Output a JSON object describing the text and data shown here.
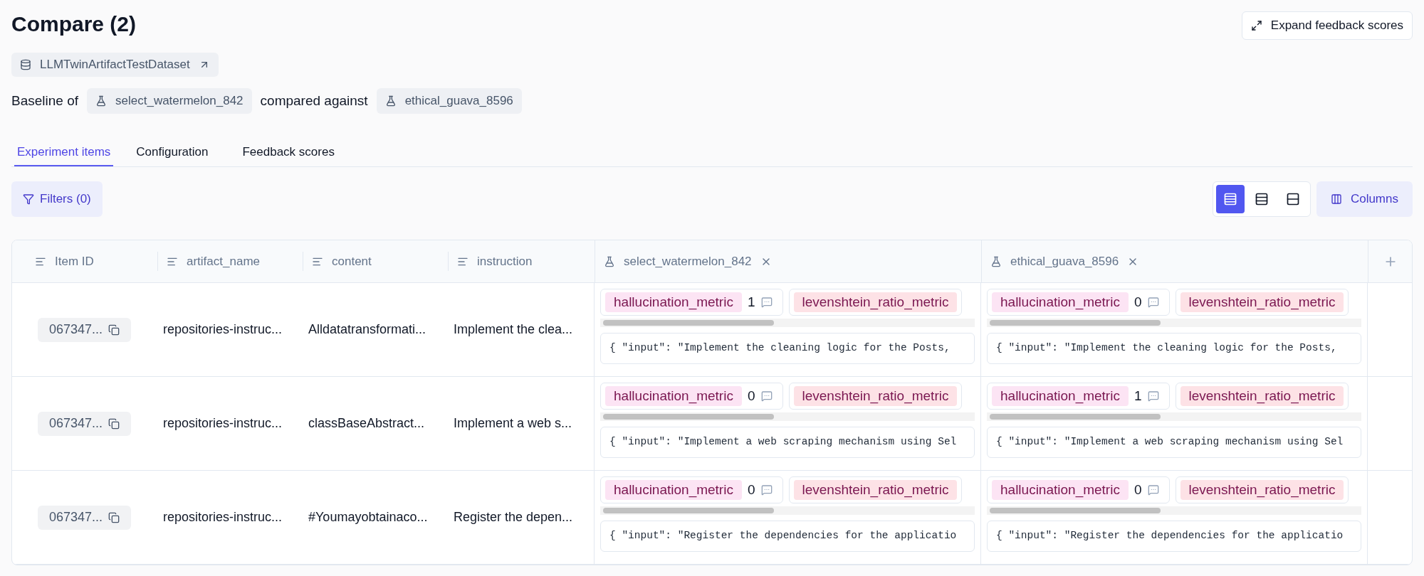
{
  "header": {
    "title": "Compare (2)",
    "expand_button": "Expand feedback scores"
  },
  "dataset": {
    "name": "LLMTwinArtifactTestDataset"
  },
  "comparison": {
    "baseline_label": "Baseline of",
    "baseline": "select_watermelon_842",
    "against_label": "compared against",
    "against": "ethical_guava_8596"
  },
  "tabs": [
    {
      "label": "Experiment items",
      "selected": true
    },
    {
      "label": "Configuration",
      "selected": false
    },
    {
      "label": "Feedback scores",
      "selected": false
    }
  ],
  "toolbar": {
    "filters": "Filters (0)",
    "row_heights": [
      {
        "kind": "large",
        "selected": true
      },
      {
        "kind": "medium",
        "selected": false
      },
      {
        "kind": "small",
        "selected": false
      }
    ],
    "columns_button": "Columns"
  },
  "table": {
    "columns": [
      "Item ID",
      "artifact_name",
      "content",
      "instruction"
    ],
    "experiment_columns": [
      "select_watermelon_842",
      "ethical_guava_8596"
    ],
    "rows": [
      {
        "item_id": "067347...",
        "artifact_name": "repositories-instruc...",
        "content": "Alldatatransformati...",
        "instruction": "Implement the clea...",
        "experiments": [
          {
            "scores": [
              {
                "name": "hallucination_metric",
                "value": "1",
                "color": "#fce4f4"
              },
              {
                "name": "levenshtein_ratio_metric",
                "color": "#fde2e6"
              }
            ],
            "output": "{ \"input\": \"Implement the cleaning logic for the Posts,"
          },
          {
            "scores": [
              {
                "name": "hallucination_metric",
                "value": "0",
                "color": "#fce4f4"
              },
              {
                "name": "levenshtein_ratio_metric",
                "color": "#fde2e6"
              }
            ],
            "output": "{ \"input\": \"Implement the cleaning logic for the Posts,"
          }
        ]
      },
      {
        "item_id": "067347...",
        "artifact_name": "repositories-instruc...",
        "content": "classBaseAbstract...",
        "instruction": "Implement a web s...",
        "experiments": [
          {
            "scores": [
              {
                "name": "hallucination_metric",
                "value": "0",
                "color": "#fce4f4"
              },
              {
                "name": "levenshtein_ratio_metric",
                "color": "#fde2e6"
              }
            ],
            "output": "{ \"input\": \"Implement a web scraping mechanism using Sel"
          },
          {
            "scores": [
              {
                "name": "hallucination_metric",
                "value": "1",
                "color": "#fce4f4"
              },
              {
                "name": "levenshtein_ratio_metric",
                "color": "#fde2e6"
              }
            ],
            "output": "{ \"input\": \"Implement a web scraping mechanism using Sel"
          }
        ]
      },
      {
        "item_id": "067347...",
        "artifact_name": "repositories-instruc...",
        "content": "#Youmayobtainaco...",
        "instruction": "Register the depen...",
        "experiments": [
          {
            "scores": [
              {
                "name": "hallucination_metric",
                "value": "0",
                "color": "#fce4f4"
              },
              {
                "name": "levenshtein_ratio_metric",
                "color": "#fde2e6"
              }
            ],
            "output": "{ \"input\": \"Register the dependencies for the applicatio"
          },
          {
            "scores": [
              {
                "name": "hallucination_metric",
                "value": "0",
                "color": "#fce4f4"
              },
              {
                "name": "levenshtein_ratio_metric",
                "color": "#fde2e6"
              }
            ],
            "output": "{ \"input\": \"Register the dependencies for the applicatio"
          }
        ]
      }
    ]
  }
}
